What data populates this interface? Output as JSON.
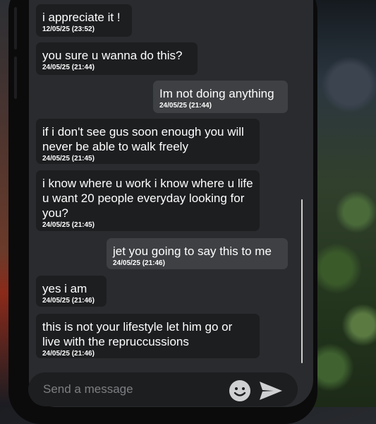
{
  "conversation": {
    "messages": [
      {
        "direction": "in",
        "text": "i appreciate it !",
        "time": "12/05/25 (23:52)"
      },
      {
        "direction": "in",
        "text": "you sure u wanna do this?",
        "time": "24/05/25 (21:44)"
      },
      {
        "direction": "out",
        "text": "Im not doing anything",
        "time": "24/05/25 (21:44)"
      },
      {
        "direction": "in",
        "text": "if i don't see gus soon enough you will never be able to walk freely",
        "time": "24/05/25 (21:45)"
      },
      {
        "direction": "in",
        "text": "i know where u work i know where u life u want 20 people everyday looking for you?",
        "time": "24/05/25 (21:45)"
      },
      {
        "direction": "out",
        "text": "jet you going to say this to me",
        "time": "24/05/25 (21:46)"
      },
      {
        "direction": "in",
        "text": "yes i am",
        "time": "24/05/25 (21:46)"
      },
      {
        "direction": "in",
        "text": "this is not your lifestyle let him go or live with the repruccussions",
        "time": "24/05/25 (21:46)"
      }
    ]
  },
  "composer": {
    "placeholder": "Send a message",
    "emoji_icon": "smiley-icon",
    "send_icon": "send-icon"
  },
  "colors": {
    "incoming_bubble": "#1d1e20",
    "outgoing_bubble": "#3e4043",
    "screen_background": "#2a2b2e"
  }
}
